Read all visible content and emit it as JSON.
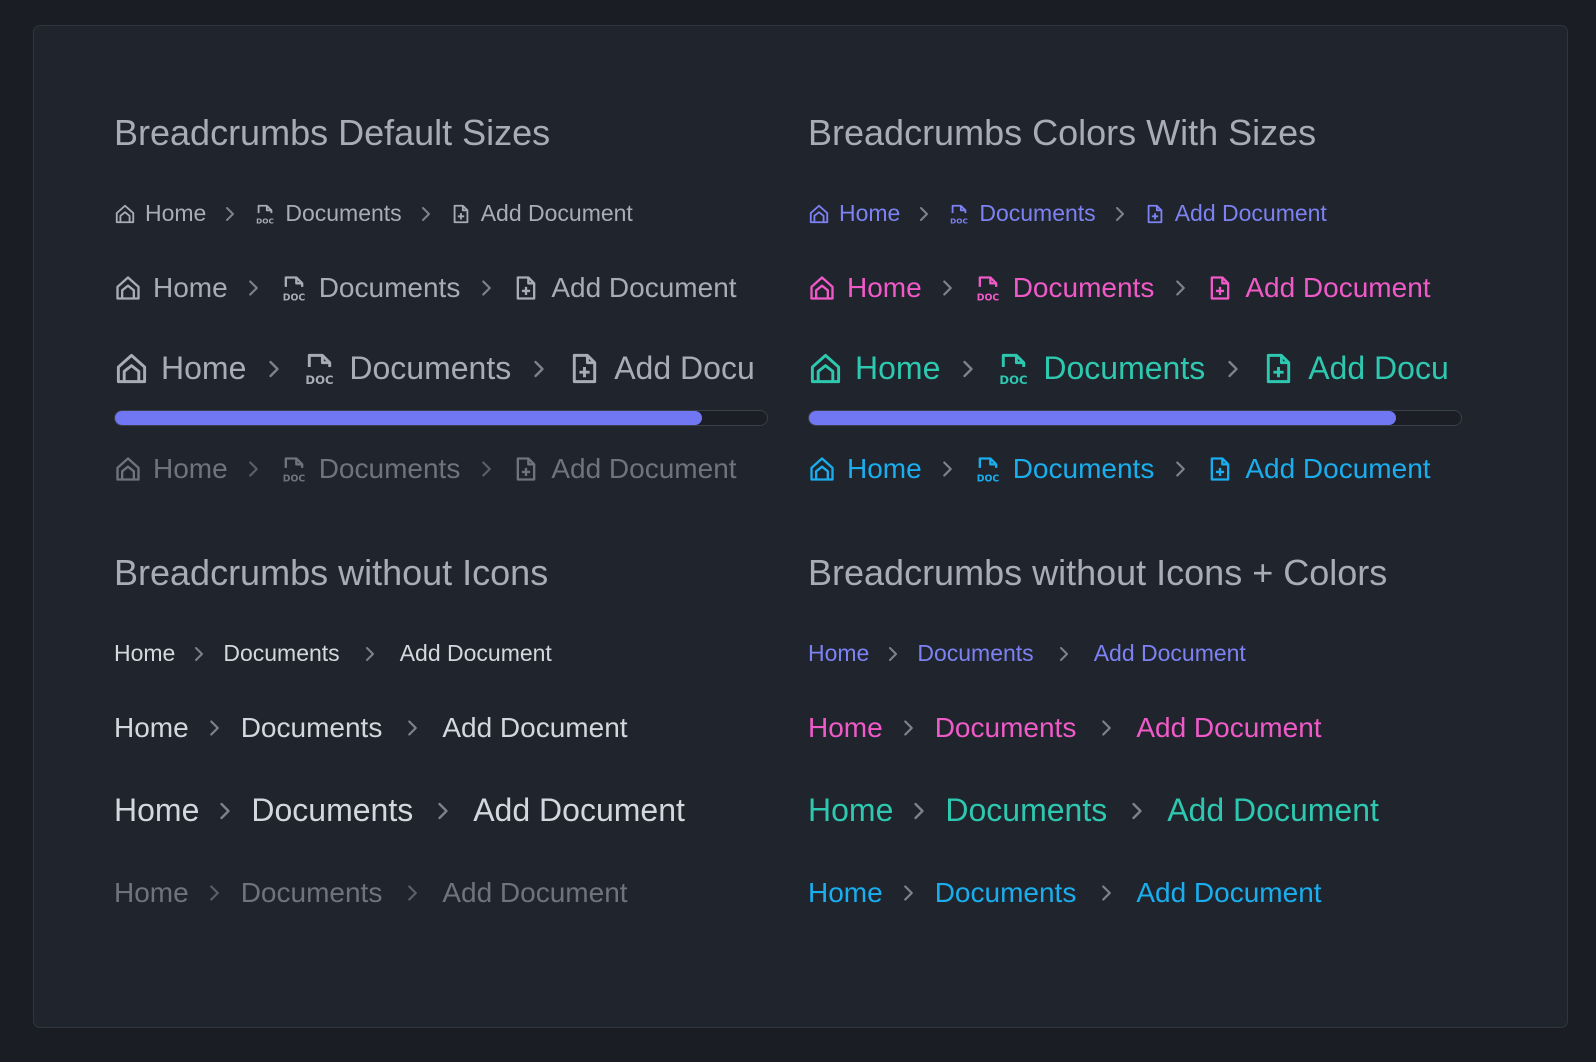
{
  "sections": {
    "default_sizes": {
      "title": "Breadcrumbs Default Sizes"
    },
    "colors_sizes": {
      "title": "Breadcrumbs Colors With Sizes"
    },
    "no_icons": {
      "title": "Breadcrumbs without Icons"
    },
    "no_icons_colors": {
      "title": "Breadcrumbs without Icons + Colors"
    }
  },
  "crumbs": {
    "home": "Home",
    "documents": "Documents",
    "add": "Add Document",
    "add_truncated": "Add Docu"
  },
  "icons": {
    "home": "home-icon",
    "documents": "doc-file-icon",
    "add": "file-plus-icon",
    "separator": "chevron-right-icon"
  },
  "progress": {
    "left_value": 0.9,
    "right_value": 0.9
  },
  "colors": {
    "default": "#a7adb7",
    "muted": "#6e747e",
    "indigo": "#7c82f3",
    "pink": "#f05ac8",
    "teal": "#2ec7b0",
    "sky": "#1aaeee",
    "progress": "#7176f2"
  }
}
